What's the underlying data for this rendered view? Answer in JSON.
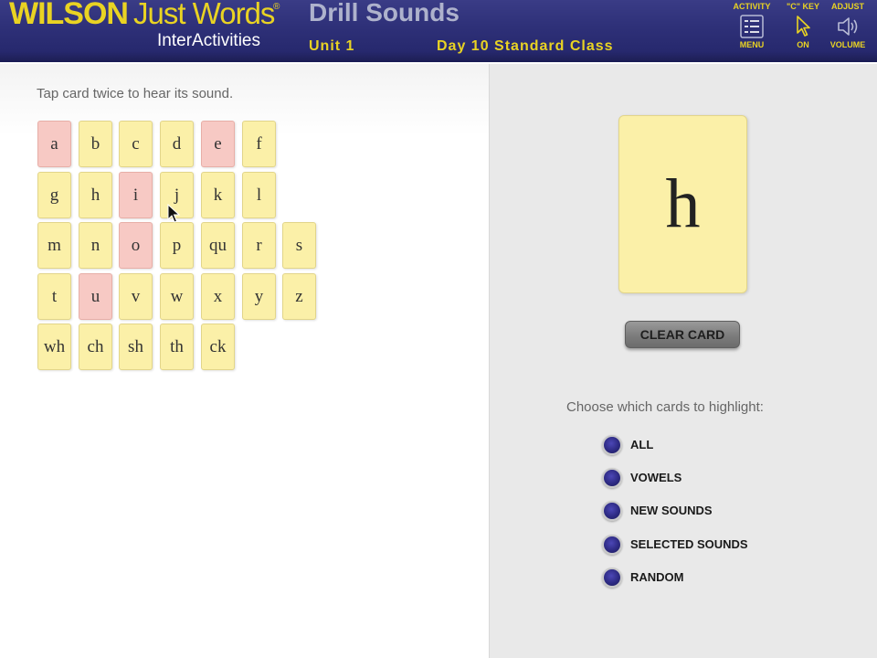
{
  "header": {
    "logo": {
      "brand": "WILSON",
      "product": "Just Words",
      "registered": "®",
      "subtitle": "InterActivities"
    },
    "title": "Drill Sounds",
    "unit": "Unit 1",
    "session": "Day 10  Standard Class",
    "buttons": [
      {
        "top_label": "ACTIVITY",
        "bottom_label": "MENU",
        "icon": "menu-list-icon"
      },
      {
        "top_label": "\"C\" KEY",
        "bottom_label": "ON",
        "icon": "cursor-arrow-icon"
      },
      {
        "top_label": "ADJUST",
        "bottom_label": "VOLUME",
        "icon": "speaker-icon"
      }
    ]
  },
  "left": {
    "instruction": "Tap card twice to hear its sound.",
    "card_rows": [
      [
        {
          "text": "a",
          "vowel": true
        },
        {
          "text": "b",
          "vowel": false
        },
        {
          "text": "c",
          "vowel": false
        },
        {
          "text": "d",
          "vowel": false
        },
        {
          "text": "e",
          "vowel": true
        },
        {
          "text": "f",
          "vowel": false
        }
      ],
      [
        {
          "text": "g",
          "vowel": false
        },
        {
          "text": "h",
          "vowel": false
        },
        {
          "text": "i",
          "vowel": true
        },
        {
          "text": "j",
          "vowel": false
        },
        {
          "text": "k",
          "vowel": false
        },
        {
          "text": "l",
          "vowel": false
        }
      ],
      [
        {
          "text": "m",
          "vowel": false
        },
        {
          "text": "n",
          "vowel": false
        },
        {
          "text": "o",
          "vowel": true
        },
        {
          "text": "p",
          "vowel": false
        },
        {
          "text": "qu",
          "vowel": false
        },
        {
          "text": "r",
          "vowel": false
        },
        {
          "text": "s",
          "vowel": false
        }
      ],
      [
        {
          "text": "t",
          "vowel": false
        },
        {
          "text": "u",
          "vowel": true
        },
        {
          "text": "v",
          "vowel": false
        },
        {
          "text": "w",
          "vowel": false
        },
        {
          "text": "x",
          "vowel": false
        },
        {
          "text": "y",
          "vowel": false
        },
        {
          "text": "z",
          "vowel": false
        }
      ],
      [
        {
          "text": "wh",
          "vowel": false
        },
        {
          "text": "ch",
          "vowel": false
        },
        {
          "text": "sh",
          "vowel": false
        },
        {
          "text": "th",
          "vowel": false
        },
        {
          "text": "ck",
          "vowel": false
        }
      ]
    ]
  },
  "right": {
    "selected_card": "h",
    "clear_button": "CLEAR CARD",
    "highlight_prompt": "Choose which cards to highlight:",
    "highlight_options": [
      "ALL",
      "VOWELS",
      "NEW SOUNDS",
      "SELECTED SOUNDS",
      "RANDOM"
    ]
  },
  "colors": {
    "header_bg": "#2e3078",
    "logo_yellow": "#e9d323",
    "card_yellow": "#fbf0a8",
    "card_vowel_pink": "#f7c9c4",
    "radio_blue": "#2d2a83",
    "right_panel_bg": "#e9e9e9"
  }
}
